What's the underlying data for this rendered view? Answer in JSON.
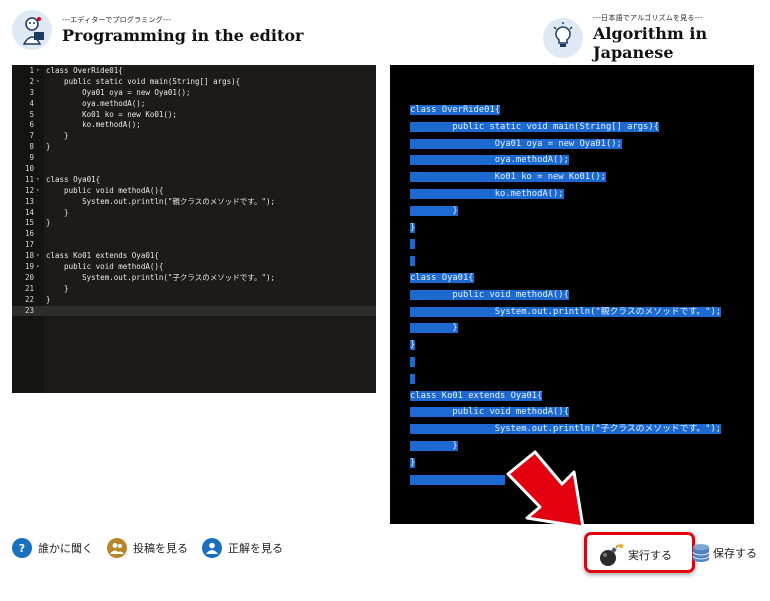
{
  "header": {
    "left_sub": "---エディターでプログラミング---",
    "left_title": "Programming in the editor",
    "right_sub": "---日本語でアルゴリズムを見る---",
    "right_title": "Algorithm in Japanese"
  },
  "editor": {
    "lines": [
      {
        "n": "1",
        "fold": "▾",
        "c": "class OverRide01{"
      },
      {
        "n": "2",
        "fold": "▾",
        "c": "    public static void main(String[] args){"
      },
      {
        "n": "3",
        "fold": "",
        "c": "        Oya01 oya = new Oya01();"
      },
      {
        "n": "4",
        "fold": "",
        "c": "        oya.methodA();"
      },
      {
        "n": "5",
        "fold": "",
        "c": "        Ko01 ko = new Ko01();"
      },
      {
        "n": "6",
        "fold": "",
        "c": "        ko.methodA();"
      },
      {
        "n": "7",
        "fold": "",
        "c": "    }"
      },
      {
        "n": "8",
        "fold": "",
        "c": "}"
      },
      {
        "n": "9",
        "fold": "",
        "c": ""
      },
      {
        "n": "10",
        "fold": "",
        "c": ""
      },
      {
        "n": "11",
        "fold": "▾",
        "c": "class Oya01{"
      },
      {
        "n": "12",
        "fold": "▾",
        "c": "    public void methodA(){"
      },
      {
        "n": "13",
        "fold": "",
        "c": "        System.out.println(\"親クラスのメソッドです。\");"
      },
      {
        "n": "14",
        "fold": "",
        "c": "    }"
      },
      {
        "n": "15",
        "fold": "",
        "c": "}"
      },
      {
        "n": "16",
        "fold": "",
        "c": ""
      },
      {
        "n": "17",
        "fold": "",
        "c": ""
      },
      {
        "n": "18",
        "fold": "▾",
        "c": "class Ko01 extends Oya01{"
      },
      {
        "n": "19",
        "fold": "▾",
        "c": "    public void methodA(){"
      },
      {
        "n": "20",
        "fold": "",
        "c": "        System.out.println(\"子クラスのメソッドです。\");"
      },
      {
        "n": "21",
        "fold": "",
        "c": "    }"
      },
      {
        "n": "22",
        "fold": "",
        "c": "}"
      },
      {
        "n": "23",
        "fold": "",
        "c": ""
      }
    ],
    "active_line": 22
  },
  "output": {
    "lines": [
      "class OverRide01{",
      "        public static void main(String[] args){",
      "                Oya01 oya = new Oya01();",
      "                oya.methodA();",
      "                Ko01 ko = new Ko01();",
      "                ko.methodA();",
      "        }",
      "}",
      "",
      "",
      "class Oya01{",
      "        public void methodA(){",
      "                System.out.println(\"親クラスのメソッドです。\");",
      "        }",
      "}",
      "",
      "",
      "class Ko01 extends Oya01{",
      "        public void methodA(){",
      "                System.out.println(\"子クラスのメソッドです。\");",
      "        }",
      "}",
      "                  "
    ]
  },
  "footer": {
    "ask": "誰かに聞く",
    "posts": "投稿を見る",
    "answer": "正解を見る",
    "run": "実行する",
    "save": "保存する"
  },
  "colors": {
    "accent_red": "#e3000f",
    "selection_blue": "#1b69d1",
    "ask_icon": "#1a6fbf",
    "posts_icon": "#b8862a",
    "answer_icon": "#1a6fbf"
  },
  "icons": [
    "programmer-avatar-icon",
    "lightbulb-icon",
    "question-icon",
    "people-icon",
    "person-check-icon",
    "bomb-icon",
    "database-icon",
    "red-arrow-icon"
  ]
}
